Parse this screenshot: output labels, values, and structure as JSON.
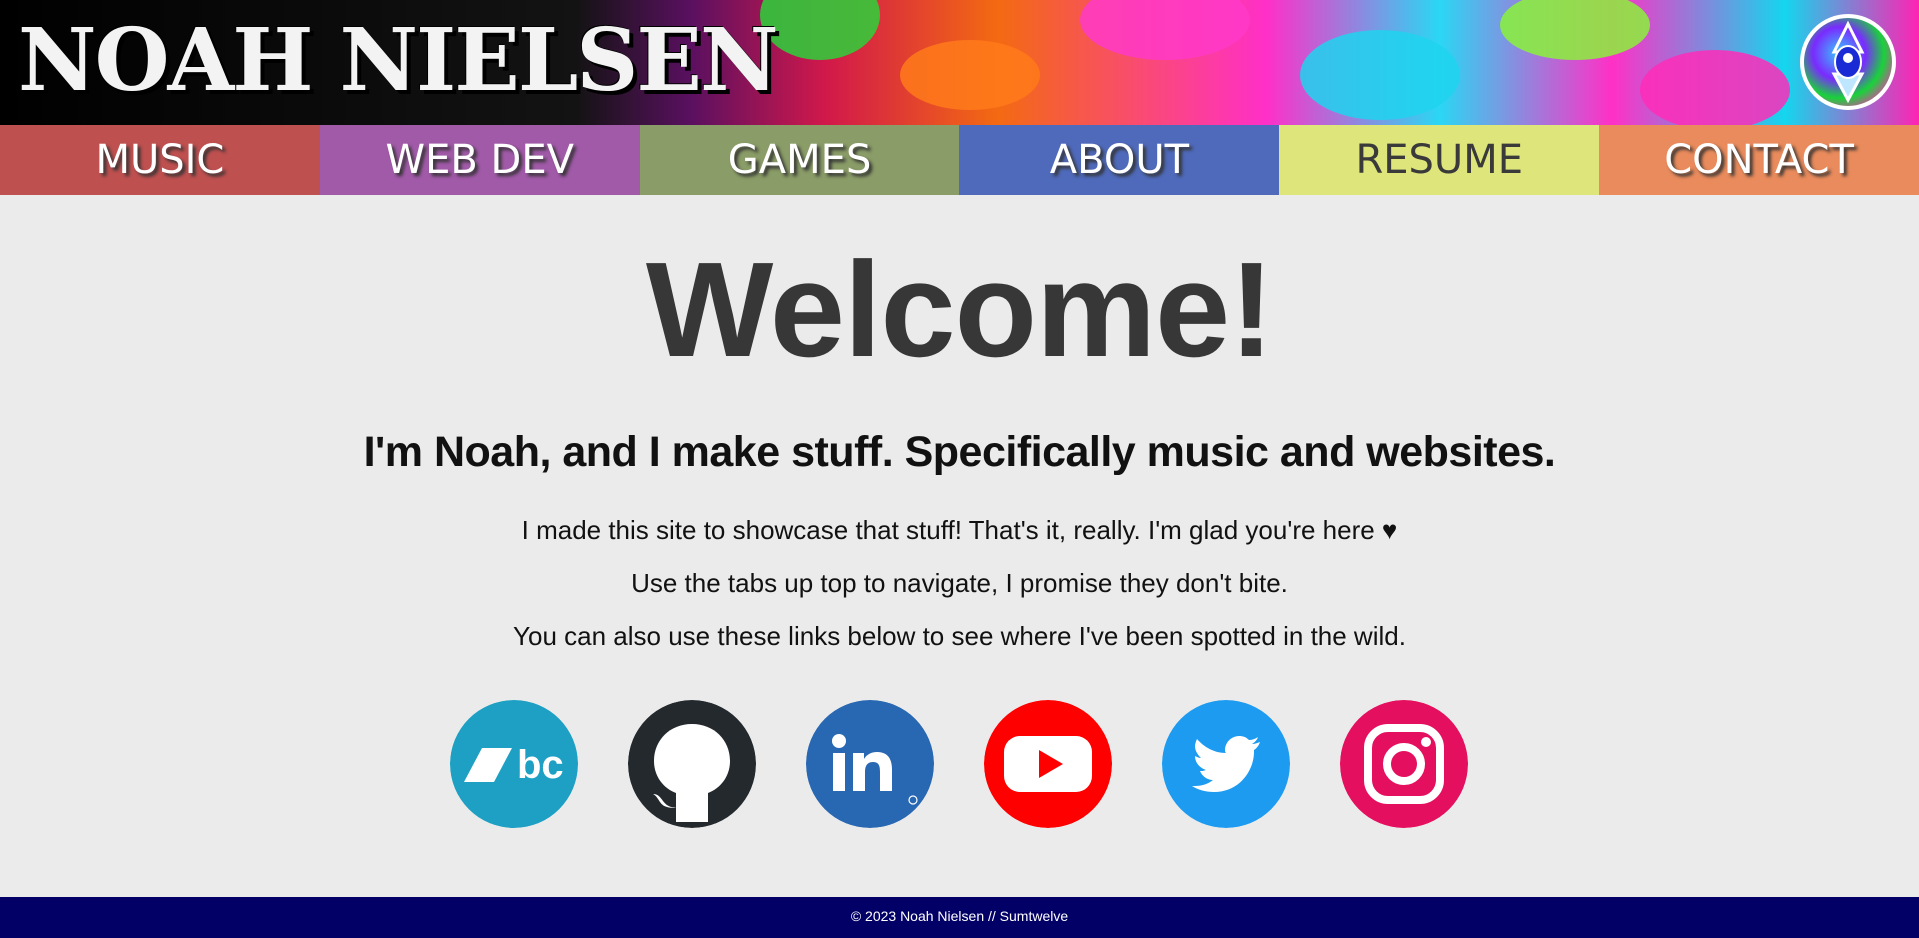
{
  "header": {
    "site_title": "NOAH NIELSEN"
  },
  "nav": {
    "items": [
      {
        "label": "MUSIC",
        "color": "#bf5050"
      },
      {
        "label": "WEB DEV",
        "color": "#a15aa8"
      },
      {
        "label": "GAMES",
        "color": "#8a9c67"
      },
      {
        "label": "ABOUT",
        "color": "#4f6abb"
      },
      {
        "label": "RESUME",
        "color": "#dde57b"
      },
      {
        "label": "CONTACT",
        "color": "#e98b5c"
      }
    ]
  },
  "main": {
    "heading": "Welcome!",
    "subtitle": "I'm Noah, and I make stuff. Specifically music and websites.",
    "paragraphs": [
      "I made this site to showcase that stuff! That's it, really. I'm glad you're here ♥",
      "Use the tabs up top to navigate, I promise they don't bite.",
      "You can also use these links below to see where I've been spotted in the wild."
    ]
  },
  "social": [
    {
      "icon": "bandcamp-icon",
      "color": "#1da0c3"
    },
    {
      "icon": "github-icon",
      "color": "#24292e"
    },
    {
      "icon": "linkedin-icon",
      "color": "#2867b2"
    },
    {
      "icon": "youtube-icon",
      "color": "#ff0000"
    },
    {
      "icon": "twitter-icon",
      "color": "#1d9bf0"
    },
    {
      "icon": "instagram-icon",
      "color": "#e4105f"
    }
  ],
  "footer": {
    "text": "© 2023 Noah Nielsen // Sumtwelve"
  }
}
